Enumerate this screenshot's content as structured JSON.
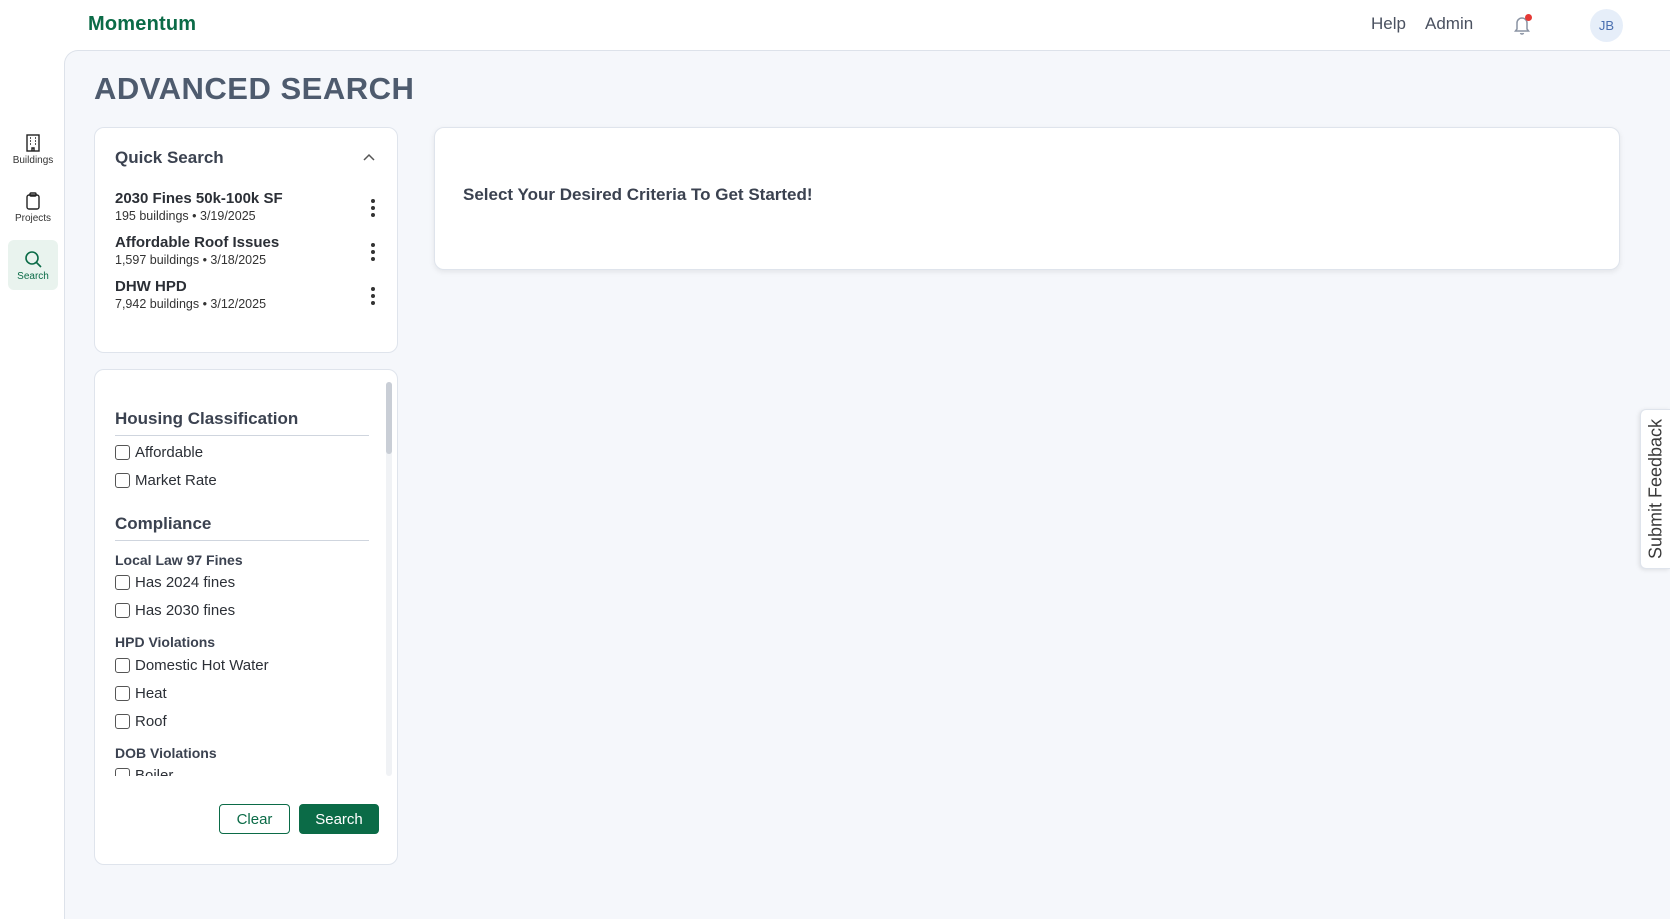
{
  "app": {
    "brand": "Momentum"
  },
  "topnav": {
    "help": "Help",
    "admin": "Admin",
    "avatar_initials": "JB",
    "notification_dot_color": "#e53935"
  },
  "rail": {
    "items": [
      {
        "label": "Buildings",
        "icon": "building-icon"
      },
      {
        "label": "Projects",
        "icon": "clipboard-icon"
      },
      {
        "label": "Search",
        "icon": "search-icon",
        "active": true
      }
    ]
  },
  "page": {
    "title": "ADVANCED SEARCH"
  },
  "quick_search": {
    "title": "Quick Search",
    "items": [
      {
        "name": "2030 Fines 50k-100k SF",
        "meta": "195 buildings • 3/19/2025"
      },
      {
        "name": "Affordable Roof Issues",
        "meta": "1,597 buildings • 3/18/2025"
      },
      {
        "name": "DHW HPD",
        "meta": "7,942 buildings • 3/12/2025"
      }
    ]
  },
  "filters": {
    "housing": {
      "title": "Housing Classification",
      "options": [
        "Affordable",
        "Market Rate"
      ]
    },
    "compliance": {
      "title": "Compliance",
      "ll97": {
        "title": "Local Law 97 Fines",
        "options": [
          "Has 2024 fines",
          "Has 2030 fines"
        ]
      },
      "hpd": {
        "title": "HPD Violations",
        "options": [
          "Domestic Hot Water",
          "Heat",
          "Roof"
        ]
      },
      "dob": {
        "title": "DOB Violations",
        "options": [
          "Boiler"
        ]
      }
    },
    "clear_label": "Clear",
    "search_label": "Search"
  },
  "results": {
    "message": "Select Your Desired Criteria To Get Started!"
  },
  "feedback": {
    "label": "Submit Feedback"
  },
  "colors": {
    "brand": "#0b6b47",
    "background": "#f5f7fb"
  }
}
